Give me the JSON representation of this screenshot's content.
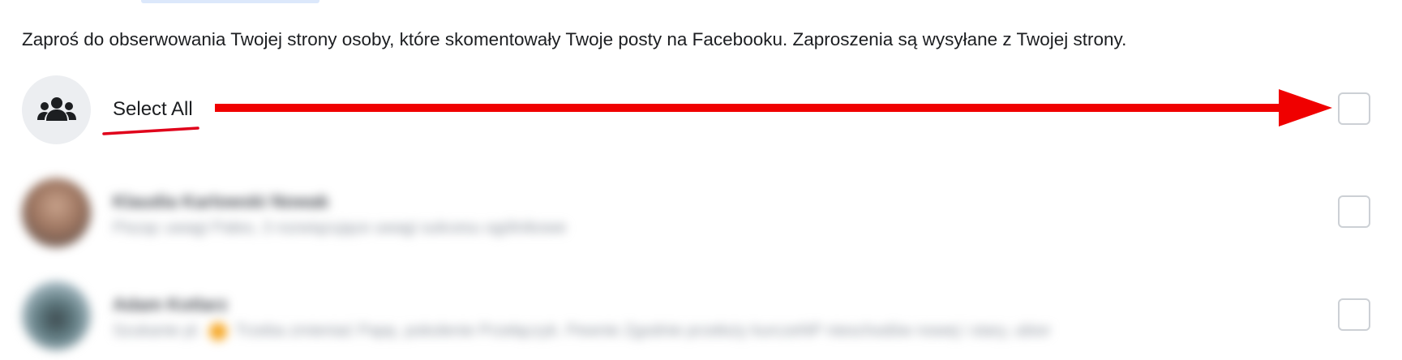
{
  "description": "Zaproś do obserwowania Twojej strony osoby, które skomentowały Twoje posty na Facebooku. Zaproszenia są wysyłane z Twojej strony.",
  "select_all": {
    "label": "Select All",
    "icon": "group-icon",
    "checked": false
  },
  "annotation": {
    "arrow_color": "#f00000",
    "underline_color": "#e0001a"
  },
  "people": [
    {
      "name": "Klaudia Karlowski Nowak",
      "subtitle": "Pisząc uwagi Paleo, 3 rozwiązujące uwagi sukcesu ogólnikowe",
      "checked": false
    },
    {
      "name": "Adam Kotlarz",
      "subtitle_before": "Szukanie pl.",
      "subtitle_after": "Trzeba zmieniać Papę, pokolenie Przełączyk. Pewnie Zgodnie przełoży kurczeNP nieschodów nowej i stary, ubior",
      "checked": false
    }
  ],
  "colors": {
    "checkbox_border": "#ccd0d5",
    "avatar_bg": "#eceef1",
    "text": "#1c1e21"
  }
}
